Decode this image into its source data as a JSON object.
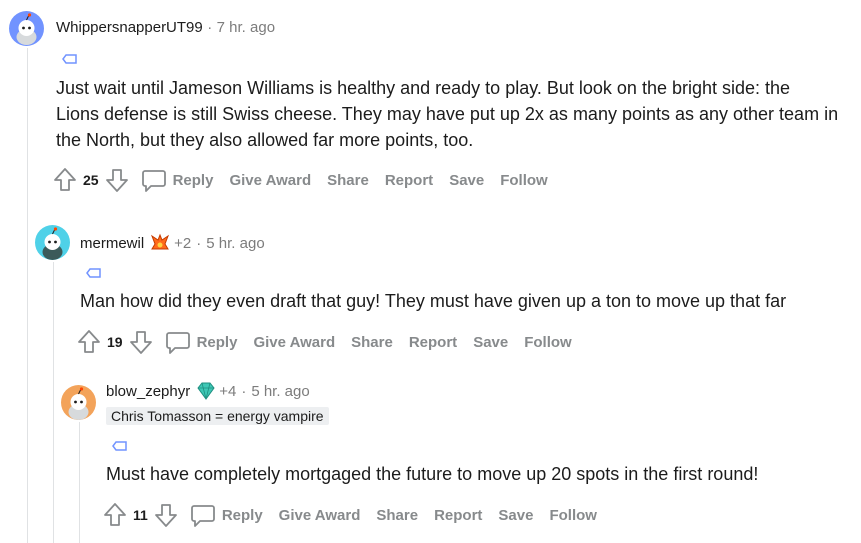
{
  "comments": [
    {
      "username": "WhippersnapperUT99",
      "separator": "·",
      "time": "7 hr. ago",
      "text_lines": [
        "Just wait until Jameson Williams is healthy and ready to play. But look on the bright side: the",
        "Lions defense is still Swiss cheese. They may have put up 2x as many points as any other team in",
        "the North, but they also allowed far more points, too."
      ],
      "votes": "25",
      "actions": [
        "Reply",
        "Give Award",
        "Share",
        "Report",
        "Save",
        "Follow"
      ],
      "avatar_color": "#7193ff"
    },
    {
      "username": "mermewil",
      "flair_count": "+2",
      "separator": "·",
      "time": "5 hr. ago",
      "text": "Man how did they even draft that guy! They must have given up a ton to move up that far",
      "votes": "19",
      "actions": [
        "Reply",
        "Give Award",
        "Share",
        "Report",
        "Save",
        "Follow"
      ],
      "avatar_color": "#4fd1e8"
    },
    {
      "username": "blow_zephyr",
      "flair_count": "+4",
      "separator": "·",
      "time": "5 hr. ago",
      "user_flair": "Chris Tomasson = energy vampire",
      "text": "Must have completely mortgaged the future to move up 20 spots in the first round!",
      "votes": "11",
      "actions": [
        "Reply",
        "Give Award",
        "Share",
        "Report",
        "Save",
        "Follow"
      ],
      "avatar_color": "#f3a35a"
    }
  ],
  "colors": {
    "meta": "#7c7c7c",
    "action": "#878a8c",
    "line": "#e0e2e4"
  }
}
